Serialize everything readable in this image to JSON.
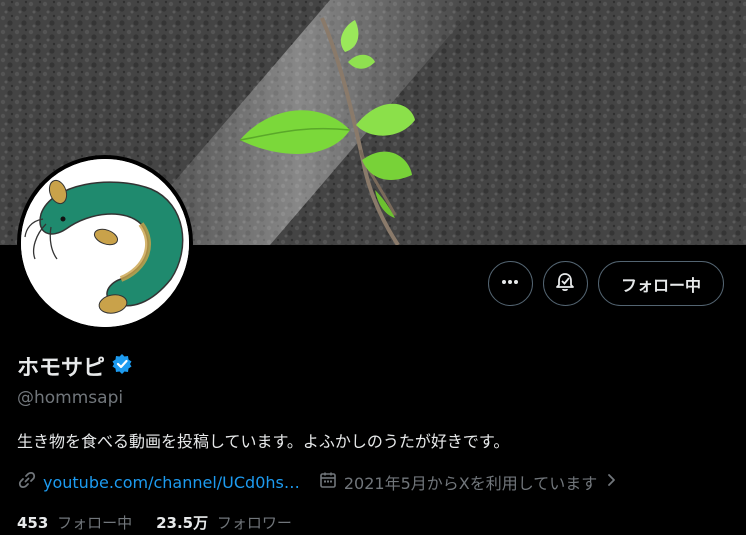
{
  "profile": {
    "display_name": "ホモサピ",
    "handle": "@hommsapi",
    "bio": "生き物を食べる動画を投稿しています。よふかしのうたが好きです。",
    "link_text": "youtube.com/channel/UCd0hs…",
    "joined": "2021年5月からXを利用しています",
    "verified": true
  },
  "actions": {
    "more_icon": "more-icon",
    "notify_icon": "bell-icon",
    "follow_label": "フォロー中"
  },
  "stats": {
    "following_count": "453",
    "following_label": "フォロー中",
    "followers_count": "23.5万",
    "followers_label": "フォロワー"
  },
  "colors": {
    "accent": "#1d9bf0",
    "muted": "#71767b",
    "text": "#e7e9ea",
    "background": "#000000"
  }
}
